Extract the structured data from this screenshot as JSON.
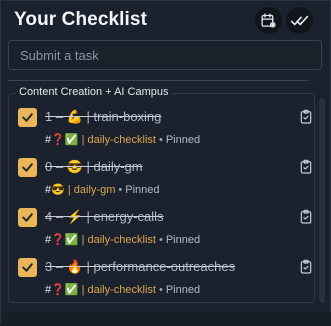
{
  "header": {
    "title": "Your Checklist"
  },
  "input": {
    "placeholder": "Submit a task"
  },
  "group": {
    "label": "Content Creation + AI Campus"
  },
  "tasks": [
    {
      "title": "1 – 💪 | train-boxing",
      "meta_prefix": "#❓✅",
      "tag": "| daily-checklist",
      "pinned": "Pinned",
      "checked": true
    },
    {
      "title": "0 – 😎 | daily-gm",
      "meta_prefix": "#😎",
      "tag": "| daily-gm",
      "pinned": "Pinned",
      "checked": true
    },
    {
      "title": "4 – ⚡ | energy-calls",
      "meta_prefix": "#❓✅",
      "tag": "| daily-checklist",
      "pinned": "Pinned",
      "checked": true
    },
    {
      "title": "3 – 🔥 | performance-outreaches",
      "meta_prefix": "#❓✅",
      "tag": "| daily-checklist",
      "pinned": "Pinned",
      "checked": true
    }
  ],
  "meta_separator": "•",
  "colors": {
    "accent": "#e9b65a",
    "background": "#1b222d",
    "tag": "#d9a54d"
  },
  "icons": {
    "calendar": "calendar-settings-icon",
    "check_all": "double-check-icon",
    "copy": "clipboard-check-icon",
    "checkbox": "check-icon"
  }
}
